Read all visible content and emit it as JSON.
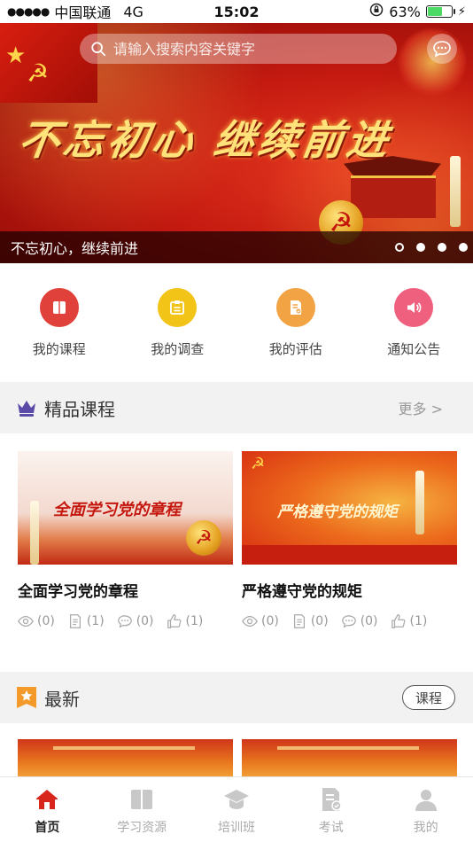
{
  "status_bar": {
    "signal": "●●●●●",
    "carrier": "中国联通",
    "network": "4G",
    "time": "15:02",
    "battery_percent": "63%",
    "battery_level": 0.63
  },
  "banner": {
    "search_placeholder": "请输入搜索内容关键字",
    "slogan": "不忘初心 继续前进",
    "caption": "不忘初心，继续前进",
    "slide_count": 4,
    "active_slide": 0
  },
  "quick_menu": [
    {
      "label": "我的课程",
      "color": "#e0413b",
      "icon": "book-icon"
    },
    {
      "label": "我的调查",
      "color": "#f2c417",
      "icon": "clipboard-icon"
    },
    {
      "label": "我的评估",
      "color": "#f2a343",
      "icon": "assessment-icon"
    },
    {
      "label": "通知公告",
      "color": "#ef5f7e",
      "icon": "speaker-icon"
    }
  ],
  "featured": {
    "title": "精品课程",
    "more": "更多 >",
    "courses": [
      {
        "title": "全面学习党的章程",
        "thumb_text": "全面学习党的章程",
        "views": "(0)",
        "notes": "(1)",
        "comments": "(0)",
        "likes": "(1)"
      },
      {
        "title": "严格遵守党的规矩",
        "thumb_text": "严格遵守党的规矩",
        "views": "(0)",
        "notes": "(0)",
        "comments": "(0)",
        "likes": "(1)"
      }
    ]
  },
  "latest": {
    "title": "最新",
    "filter_label": "课程"
  },
  "tab_bar": [
    {
      "label": "首页",
      "icon": "home-icon",
      "active": true
    },
    {
      "label": "学习资源",
      "icon": "book-open-icon",
      "active": false
    },
    {
      "label": "培训班",
      "icon": "graduation-cap-icon",
      "active": false
    },
    {
      "label": "考试",
      "icon": "exam-icon",
      "active": false
    },
    {
      "label": "我的",
      "icon": "user-icon",
      "active": false
    }
  ],
  "colors": {
    "accent_red": "#d8261c",
    "section_bg": "#f2f2f2",
    "crown_purple": "#5b4aa8",
    "star_badge_orange": "#f39a2a"
  }
}
